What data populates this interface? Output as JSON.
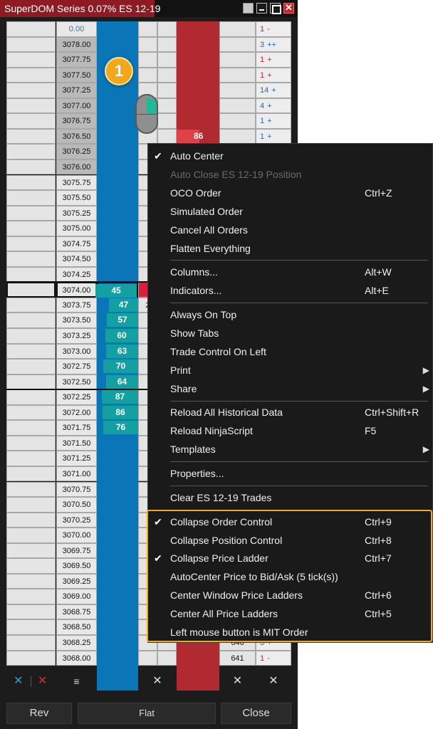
{
  "window": {
    "title": "SuperDOM Series 0.07% ES 12-19",
    "close_glyph": "✕"
  },
  "ladder": {
    "rows": [
      {
        "price": "0.00",
        "top": true,
        "vol": "1",
        "sign": "-",
        "vol_red": true,
        "sign_red": true
      },
      {
        "price": "3078.00",
        "ask_zone": true,
        "vol": "3",
        "sign": "++",
        "vol_red": false,
        "sign_red": false
      },
      {
        "price": "3077.75",
        "ask_zone": true,
        "vol": "1",
        "sign": "+",
        "vol_red": true,
        "sign_red": true
      },
      {
        "price": "3077.50",
        "ask_zone": true,
        "vol": "1",
        "sign": "+",
        "vol_red": true,
        "sign_red": true
      },
      {
        "price": "3077.25",
        "ask_zone": true,
        "vol": "14",
        "sign": "+",
        "vol_red": false,
        "sign_red": false
      },
      {
        "price": "3077.00",
        "ask_zone": true,
        "vol": "4",
        "sign": "+",
        "vol_red": false,
        "sign_red": false
      },
      {
        "price": "3076.75",
        "ask_zone": true,
        "vol": "1",
        "sign": "+",
        "vol_red": false,
        "sign_red": false
      },
      {
        "price": "3076.50",
        "ask_zone": true,
        "ask": "86",
        "vol": "1",
        "sign": "+",
        "vol_red": false,
        "sign_red": false
      },
      {
        "price": "3076.25",
        "ask_zone": true
      },
      {
        "price": "3076.00",
        "ask_zone": true
      },
      {
        "price": "3075.75"
      },
      {
        "price": "3075.50"
      },
      {
        "price": "3075.25"
      },
      {
        "price": "3075.00"
      },
      {
        "price": "3074.75"
      },
      {
        "price": "3074.50"
      },
      {
        "price": "3074.25"
      },
      {
        "price": "3074.00",
        "current": true,
        "bid": "45",
        "bid_frac": 1.0
      },
      {
        "price": "3073.75",
        "bid": "47",
        "bid_frac": 0.7,
        "x1": "2"
      },
      {
        "price": "3073.50",
        "bid": "57",
        "bid_frac": 0.75
      },
      {
        "price": "3073.25",
        "bid": "60",
        "bid_frac": 0.8
      },
      {
        "price": "3073.00",
        "bid": "63",
        "bid_frac": 0.78
      },
      {
        "price": "3072.75",
        "bid": "70",
        "bid_frac": 0.84
      },
      {
        "price": "3072.50",
        "bid": "64",
        "bid_frac": 0.78
      },
      {
        "price": "3072.25",
        "bid": "87",
        "bid_frac": 0.88
      },
      {
        "price": "3072.00",
        "bid": "86",
        "bid_frac": 0.86
      },
      {
        "price": "3071.75",
        "bid": "76",
        "bid_frac": 0.84
      },
      {
        "price": "3071.50"
      },
      {
        "price": "3071.25"
      },
      {
        "price": "3071.00"
      },
      {
        "price": "3070.75"
      },
      {
        "price": "3070.50"
      },
      {
        "price": "3070.25"
      },
      {
        "price": "3070.00"
      },
      {
        "price": "3069.75"
      },
      {
        "price": "3069.50"
      },
      {
        "price": "3069.25"
      },
      {
        "price": "3069.00"
      },
      {
        "price": "3068.75"
      },
      {
        "price": "3068.50"
      },
      {
        "price": "3068.25",
        "so": "646",
        "vol": "3",
        "sign": "+",
        "vol_red": false,
        "sign_red": false
      },
      {
        "price": "3068.00",
        "so": "641",
        "vol": "1",
        "sign": "-",
        "vol_red": true,
        "sign_red": true
      }
    ],
    "cancel_row": {
      "buy_cancel": "✕",
      "sell_cancel": "✕",
      "menu_glyph": "≡",
      "x_cancel": "✕",
      "so_cancel": "✕",
      "vol_cancel": "✕"
    }
  },
  "toolbar": {
    "rev_label": "Rev",
    "flat_label": "Flat",
    "close_label": "Close"
  },
  "badge": "1",
  "icons": [
    "close-icon",
    "minimize-icon",
    "maximize-icon",
    "mouse-icon",
    "checkmark-icon",
    "submenu-arrow-icon",
    "menu-icon"
  ],
  "context_menu": {
    "items": [
      {
        "label": "Auto Center",
        "checked": true
      },
      {
        "label": "Auto Close ES 12-19 Position",
        "disabled": true
      },
      {
        "label": "OCO Order",
        "shortcut": "Ctrl+Z"
      },
      {
        "label": "Simulated Order"
      },
      {
        "label": "Cancel All Orders"
      },
      {
        "label": "Flatten Everything",
        "sep_after": true
      },
      {
        "label": "Columns...",
        "shortcut": "Alt+W"
      },
      {
        "label": "Indicators...",
        "shortcut": "Alt+E",
        "sep_after": true
      },
      {
        "label": "Always On Top"
      },
      {
        "label": "Show Tabs"
      },
      {
        "label": "Trade Control On Left"
      },
      {
        "label": "Print",
        "submenu": true
      },
      {
        "label": "Share",
        "submenu": true,
        "sep_after": true
      },
      {
        "label": "Reload All Historical Data",
        "shortcut": "Ctrl+Shift+R"
      },
      {
        "label": "Reload NinjaScript",
        "shortcut": "F5"
      },
      {
        "label": "Templates",
        "submenu": true,
        "sep_after": true
      },
      {
        "label": "Properties...",
        "sep_after": true
      },
      {
        "label": "Clear ES 12-19 Trades",
        "sep_after": true
      },
      {
        "label": "Collapse Order Control",
        "shortcut": "Ctrl+9",
        "checked": true
      },
      {
        "label": "Collapse Position Control",
        "shortcut": "Ctrl+8"
      },
      {
        "label": "Collapse Price Ladder",
        "shortcut": "Ctrl+7",
        "checked": true
      },
      {
        "label": "AutoCenter Price to Bid/Ask (5 tick(s))"
      },
      {
        "label": "Center Window Price Ladders",
        "shortcut": "Ctrl+6"
      },
      {
        "label": "Center All Price Ladders",
        "shortcut": "Ctrl+5"
      },
      {
        "label": "Left mouse button is MIT Order"
      }
    ],
    "check_glyph": "✔",
    "arrow_glyph": "▶"
  },
  "colors": {
    "title_bg": "#8e1b23",
    "buy_col": "#0a76b7",
    "sell_col": "#b02a30",
    "bid_bar": "#12a0a0",
    "ask_bar": "#e04048",
    "highlight": "#f2a81b"
  }
}
